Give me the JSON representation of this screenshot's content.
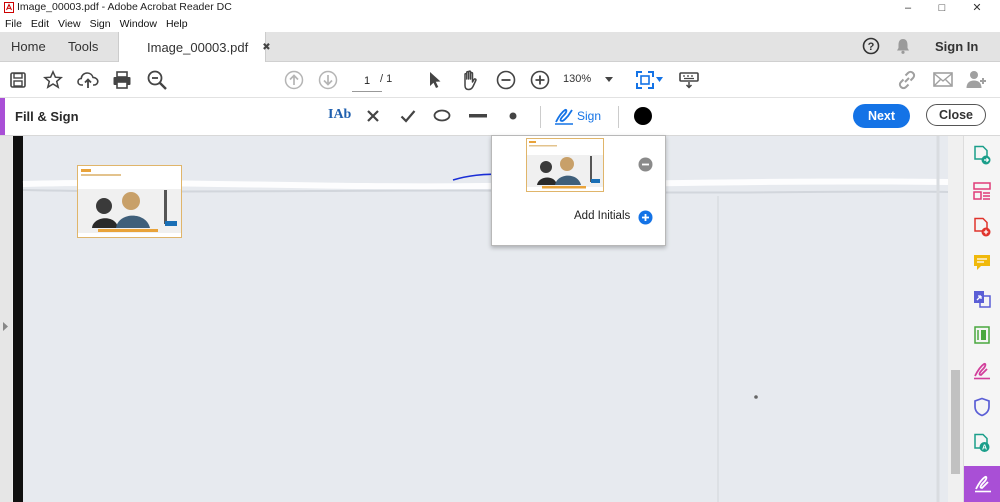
{
  "window": {
    "title": "Image_00003.pdf - Adobe Acrobat Reader DC",
    "controls": [
      "–",
      "□",
      "✕"
    ]
  },
  "menu": [
    "File",
    "Edit",
    "View",
    "Sign",
    "Window",
    "Help"
  ],
  "tabs": {
    "home": "Home",
    "tools": "Tools",
    "document": "Image_00003.pdf",
    "document_close": "✖",
    "sign_in": "Sign In"
  },
  "toolbar": {
    "current_page": "1",
    "total_pages": "/ 1",
    "zoom": "130%"
  },
  "fill_sign": {
    "title": "Fill & Sign",
    "text_tool": "IAb",
    "sign_label": "Sign",
    "next": "Next",
    "close": "Close"
  },
  "initials_popup": {
    "add_initials": "Add Initials"
  },
  "colors": {
    "accent_purple": "#a94fd6",
    "primary_blue": "#1473e6",
    "sign_blue": "#1473e6",
    "annotation_ink": "#1a2ed6"
  },
  "icons": [
    "save-icon",
    "bookmark-star-icon",
    "upload-cloud-icon",
    "print-icon",
    "zoom-search-icon",
    "page-up-icon",
    "page-down-icon",
    "select-cursor-icon",
    "hand-icon",
    "zoom-out-icon",
    "zoom-in-icon",
    "page-fit-icon",
    "keyboard-icon",
    "help-icon",
    "bell-icon",
    "link-icon",
    "mail-icon",
    "add-user-icon"
  ]
}
